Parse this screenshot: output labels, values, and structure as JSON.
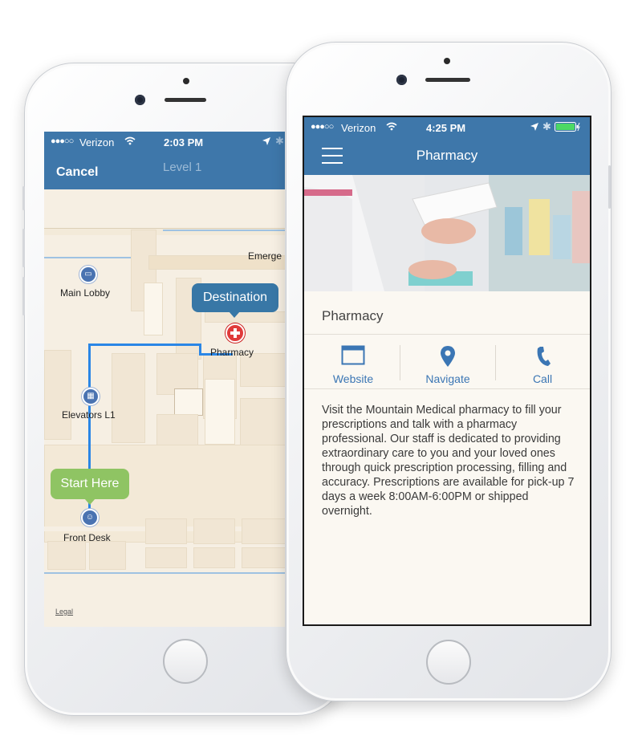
{
  "back_phone": {
    "status": {
      "carrier": "Verizon",
      "time": "2:03 PM"
    },
    "header": {
      "cancel_label": "Cancel",
      "level_label": "Level 1"
    },
    "map": {
      "labels": {
        "main_lobby": "Main Lobby",
        "emergency": "Emerge",
        "pharmacy": "Pharmacy",
        "elevators": "Elevators L1",
        "front_desk": "Front Desk"
      },
      "destination_label": "Destination",
      "start_label": "Start Here",
      "legal_label": "Legal"
    }
  },
  "front_phone": {
    "status": {
      "carrier": "Verizon",
      "time": "4:25 PM"
    },
    "header": {
      "title": "Pharmacy"
    },
    "section_title": "Pharmacy",
    "actions": [
      {
        "label": "Website",
        "icon": "window-icon"
      },
      {
        "label": "Navigate",
        "icon": "map-pin-icon"
      },
      {
        "label": "Call",
        "icon": "phone-icon"
      }
    ],
    "description": "Visit the Mountain Medical pharmacy to fill your prescriptions and talk with a pharmacy professional. Our staff is dedicated to providing extraordinary care to you and your loved ones through quick prescription processing, filling and accuracy. Prescriptions are available for pick-up 7 days a week 8:00AM-6:00PM or shipped overnight."
  },
  "colors": {
    "header_blue": "#3e77aa",
    "action_blue": "#3b76b4",
    "route_blue": "#2a86e6",
    "start_green": "#8fc463",
    "destination_blue": "#3877a6",
    "pharmacy_red": "#e03a3a"
  }
}
